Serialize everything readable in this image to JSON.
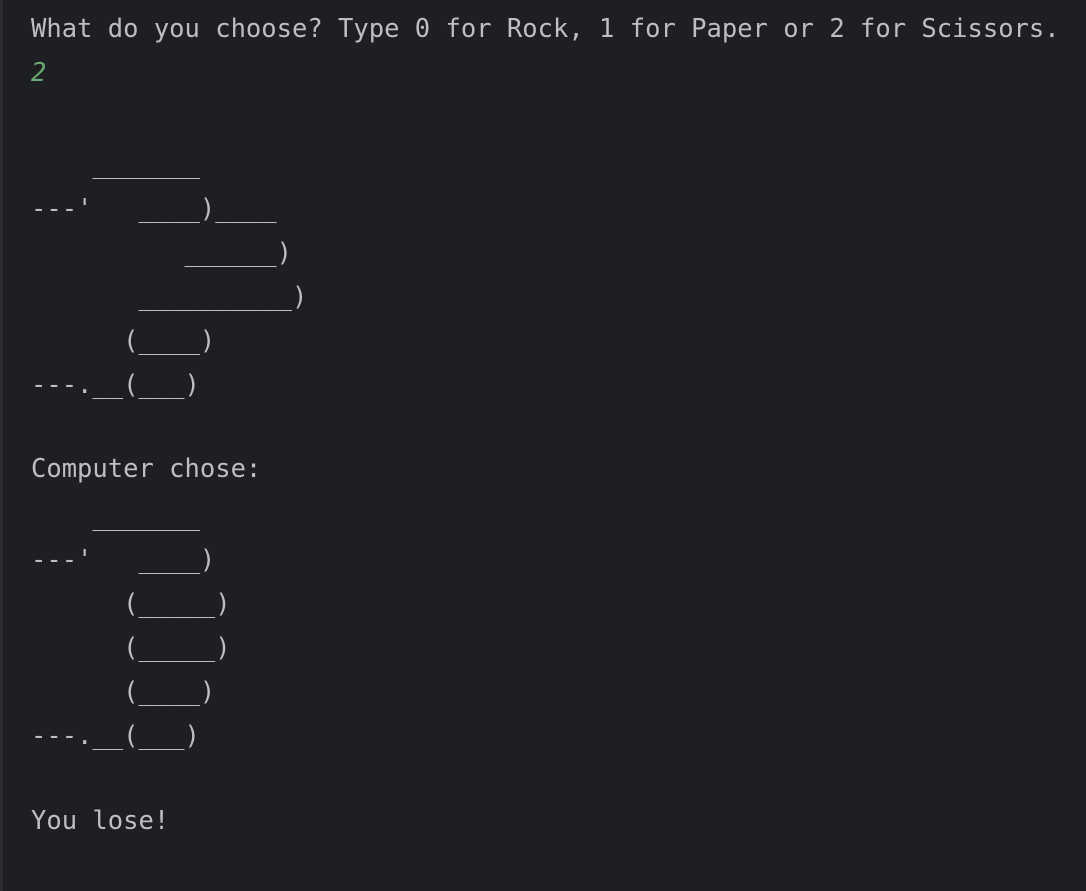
{
  "console": {
    "prompt": "What do you choose? Type 0 for Rock, 1 for Paper or 2 for Scissors.",
    "user_input": "2",
    "player_art": [
      "    _______",
      "---'   ____)____",
      "          ______)",
      "       __________)",
      "      (____)",
      "---.__(___)"
    ],
    "computer_label": "Computer chose:",
    "computer_art": [
      "    _______",
      "---'   ____)",
      "      (_____)",
      "      (_____)",
      "      (____)",
      "---.__(___)"
    ],
    "result": "You lose!"
  },
  "colors": {
    "background": "#1e1f22",
    "text": "#bcbec4",
    "input": "#6aab73"
  }
}
